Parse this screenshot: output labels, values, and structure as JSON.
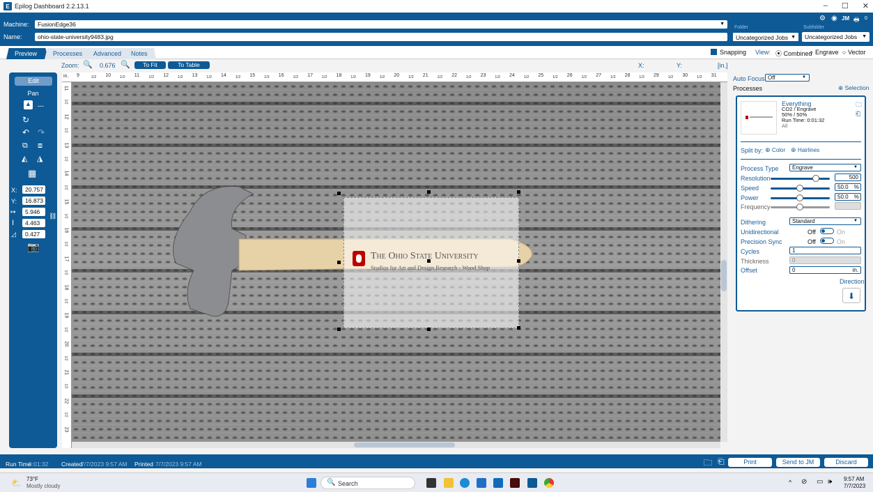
{
  "window": {
    "title": "Epilog Dashboard 2.2.13.1",
    "controls": [
      "–",
      "☐",
      "✕"
    ]
  },
  "header": {
    "machine_label": "Machine:",
    "machine_value": "FusionEdge36",
    "name_label": "Name:",
    "name_value": "ohio-state-university9483.jpg",
    "folder_label": "Folder",
    "folder_value": "Uncategorized Jobs",
    "subfolder_label": "Subfolder",
    "subfolder_value": "Uncategorized Jobs",
    "user_initials": "JM",
    "queue_count": "0"
  },
  "tabs": [
    {
      "label": "Preview"
    },
    {
      "label": "Processes"
    },
    {
      "label": "Advanced"
    },
    {
      "label": "Notes"
    }
  ],
  "view": {
    "snapping_label": "Snapping",
    "view_label": "View:",
    "options": [
      "Combined",
      "Engrave",
      "Vector"
    ]
  },
  "zoom": {
    "label": "Zoom:",
    "value": "0.676",
    "to_fit": "To Fit",
    "to_table": "To Table",
    "x_label": "X:",
    "y_label": "Y:",
    "unit": "[in.]"
  },
  "ruler": {
    "unit": "in.",
    "top": [
      "9",
      "1/2",
      "10",
      "1/2",
      "11",
      "1/2",
      "12",
      "1/2",
      "13",
      "1/2",
      "14",
      "1/2",
      "15",
      "1/2",
      "16",
      "1/2",
      "17",
      "1/2",
      "18",
      "1/2",
      "19",
      "1/2",
      "20",
      "1/2",
      "21",
      "1/2",
      "22",
      "1/2",
      "23",
      "1/2",
      "24",
      "1/2",
      "25",
      "1/2",
      "26",
      "1/2",
      "27",
      "1/2",
      "28",
      "1/2",
      "29",
      "1/2",
      "30",
      "1/2",
      "31"
    ],
    "left": [
      "11",
      "1/2",
      "12",
      "1/2",
      "13",
      "1/2",
      "14",
      "1/2",
      "15",
      "1/2",
      "16",
      "1/2",
      "17",
      "1/2",
      "18",
      "1/2",
      "19",
      "1/2",
      "20",
      "1/2",
      "21",
      "1/2",
      "22",
      "1/2",
      "23"
    ]
  },
  "tools": {
    "edit": "Edit",
    "pan": "Pan",
    "dashes": "---",
    "x_label": "X:",
    "x": "20.757",
    "y_label": "Y:",
    "y": "16.873",
    "w": "5.946",
    "h": "4.463",
    "angle": "0.427"
  },
  "logo": {
    "line1": "The Ohio State University",
    "line2": "Studios for Art and Design Research - Wood Shop"
  },
  "panel": {
    "autofocus_label": "Auto Focus",
    "autofocus_value": "Off",
    "processes_label": "Processes",
    "selection_label": "Selection",
    "process": {
      "name": "Everything",
      "line2": "CO2 / Engrave",
      "line3": "50% / 50%",
      "line4": "Run Time: 0:01:32",
      "line5": "All"
    },
    "split_by": "Split by:",
    "color": "Color",
    "hairlines": "Hairlines",
    "process_type_label": "Process Type",
    "process_type": "Engrave",
    "resolution_label": "Resolution",
    "resolution": "500",
    "speed_label": "Speed",
    "speed": "50.0",
    "power_label": "Power",
    "power": "50.0",
    "pct": "%",
    "speed_level": 0.5,
    "power_level": 0.5,
    "frequency_level": 0.5,
    "frequency_label": "Frequency",
    "dithering_label": "Dithering",
    "dithering": "Standard",
    "unidirectional_label": "Unidirectional",
    "precision_label": "Precision Sync",
    "off": "Off",
    "on": "On",
    "cycles_label": "Cycles",
    "cycles": "1",
    "thickness_label": "Thickness",
    "thickness": "0",
    "offset_label": "Offset",
    "offset": "0",
    "offset_unit": "in.",
    "direction_label": "Direction"
  },
  "status": {
    "runtime_label": "Run Time",
    "runtime": "0:01:32",
    "created_label": "Created",
    "created": "7/7/2023 9:57 AM",
    "printed_label": "Printed",
    "printed": "7/7/2023 9:57 AM",
    "print": "Print",
    "send": "Send to JM",
    "discard": "Discard"
  },
  "taskbar": {
    "temp": "73°F",
    "weather": "Mostly cloudy",
    "search": "Search",
    "time": "9:57 AM",
    "date": "7/7/2023"
  },
  "colors": {
    "brand": "#0d5a96",
    "osu_red": "#bb0000"
  }
}
